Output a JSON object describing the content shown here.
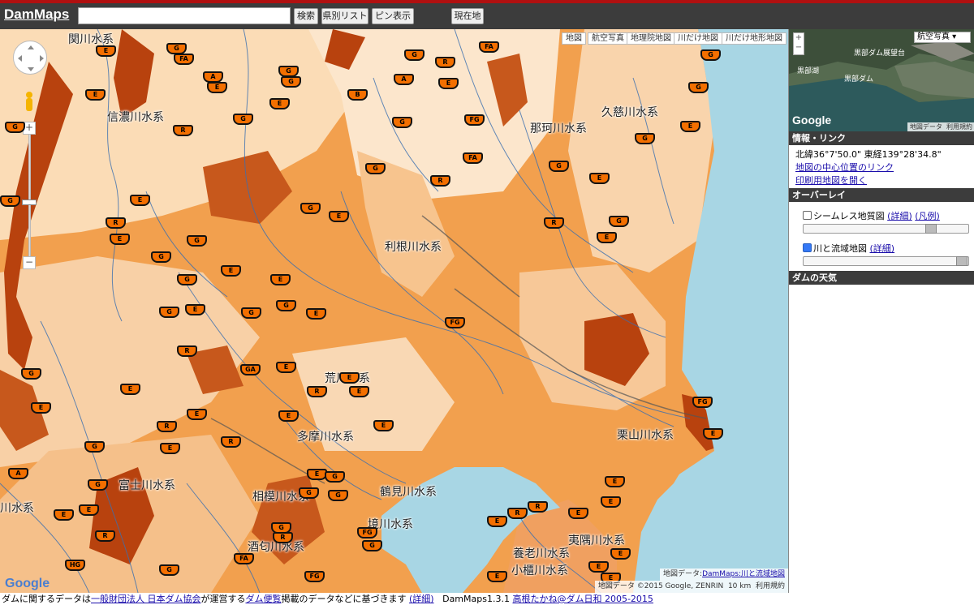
{
  "header": {
    "logo": "DamMaps",
    "search_value": "",
    "buttons": [
      "検索",
      "県別リスト",
      "ピン表示",
      "現在地"
    ]
  },
  "map": {
    "map_types": [
      "地図",
      "航空写真",
      "地理院地図",
      "川だけ地図",
      "川だけ地形地図"
    ],
    "river_systems": [
      "関川水系",
      "信濃川水系",
      "那珂川水系",
      "久慈川水系",
      "利根川水系",
      "荒川水系",
      "多摩川水系",
      "富士川水系",
      "相模川水系",
      "鶴見川水系",
      "境川水系",
      "酒匂川水系",
      "栗山川水系",
      "夷隅川水系",
      "養老川水系",
      "小櫃川水系",
      "川水系"
    ],
    "attribution_prefix": "地図データ:",
    "attribution_link": "DamMaps:川と流域地図",
    "copyright": "地図データ ©2015 Google, ZENRIN",
    "scale": "10 km",
    "terms": "利用規約",
    "google": "Google",
    "colors": {
      "land": "#f2a04e",
      "light": "#fbe0c0",
      "dark": "#b8420e",
      "sea": "#a8d6e4",
      "river": "#3a6fb0"
    }
  },
  "panel": {
    "overview": {
      "type_select": "航空写真",
      "labels": [
        "黒部ダム展望台",
        "黒部湖",
        "黒部ダム"
      ],
      "data_label": "地図データ",
      "terms": "利用規約",
      "google": "Google"
    },
    "info_title": "情報・リンク",
    "coordinates": "北緯36°7'50.0\" 東経139°28'34.8\"",
    "link_center": "地図の中心位置のリンク",
    "link_print": "印刷用地図を開く",
    "overlay_title": "オーバーレイ",
    "overlay1": {
      "label": "シームレス地質図",
      "detail": "(詳細)",
      "legend": "(凡例)",
      "checked": false
    },
    "overlay2": {
      "label": "川と流域地図",
      "detail": "(詳細)",
      "checked": true
    },
    "weather_title": "ダムの天気"
  },
  "footer": {
    "t1": "ダムに関するデータは",
    "l1": "一般財団法人 日本ダム協会",
    "t2": "が運営する",
    "l2": "ダム便覧",
    "t3": "掲載のデータなどに基づきます",
    "l3": "(詳細)",
    "version": "DamMaps1.3.1",
    "author": "高根たかね@ダム日和 2005-2015"
  }
}
